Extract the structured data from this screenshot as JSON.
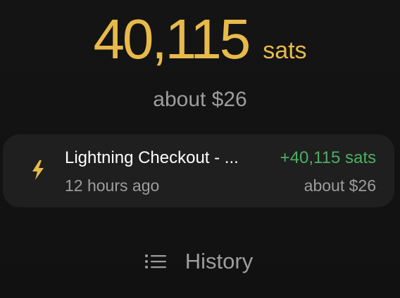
{
  "balance": {
    "amount": "40,115",
    "unit": "sats",
    "fiat": "about $26"
  },
  "transaction": {
    "icon": "lightning-bolt-icon",
    "title": "Lightning Checkout - ...",
    "time": "12 hours ago",
    "amount": "+40,115 sats",
    "fiat": "about $26"
  },
  "history": {
    "icon": "list-icon",
    "label": "History"
  },
  "colors": {
    "accent": "#E8BA4A",
    "positive": "#4CAF63",
    "muted": "#9D9D9D",
    "card": "#1F1F1F",
    "background": "#121212"
  }
}
